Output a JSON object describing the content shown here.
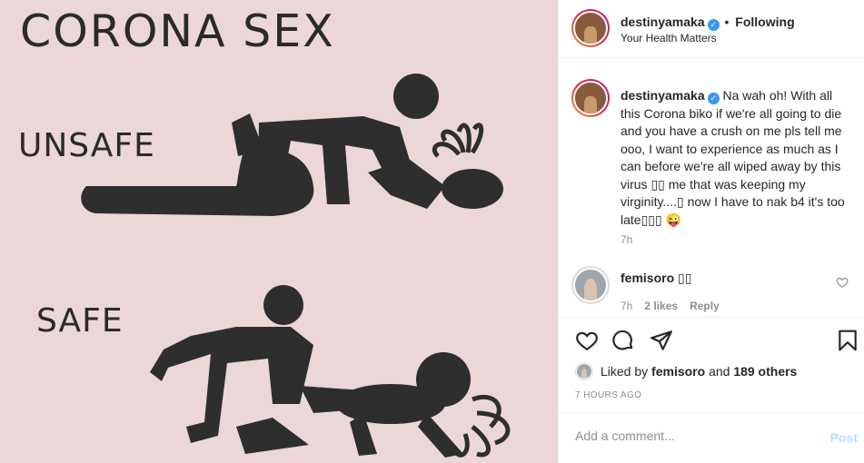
{
  "meme": {
    "title": "CORONA SEX",
    "unsafe_label": "UNSAFE",
    "safe_label": "SAFE"
  },
  "header": {
    "username": "destinyamaka",
    "verified": true,
    "separator": "•",
    "follow_status": "Following",
    "location": "Your Health Matters",
    "more_icon": "more-horizontal-icon"
  },
  "caption": {
    "username": "destinyamaka",
    "text": "Na wah oh! With all this Corona biko if we're all going to die and you have a crush on me pls tell me ooo, I want to experience as much as I can before we're all wiped away by this virus ▯▯ me that was keeping my virginity....▯ now I have to nak b4 it's too late▯▯▯ 😜",
    "time": "7h"
  },
  "comment": {
    "username": "femisoro",
    "text": "▯▯",
    "time": "7h",
    "likes": "2 likes",
    "reply_label": "Reply",
    "like_icon": "heart-outline-icon"
  },
  "actions": {
    "like_icon": "heart-icon",
    "comment_icon": "comment-icon",
    "share_icon": "paper-plane-icon",
    "save_icon": "bookmark-icon"
  },
  "likes": {
    "prefix": "Liked by",
    "user": "femisoro",
    "connector": "and",
    "others": "189 others"
  },
  "timestamp": "7 HOURS AGO",
  "add_comment": {
    "placeholder": "Add a comment...",
    "post_label": "Post"
  },
  "colors": {
    "image_background": "#ebd6d8",
    "verified_blue": "#3897f0",
    "post_button_disabled": "#b2dffc"
  }
}
